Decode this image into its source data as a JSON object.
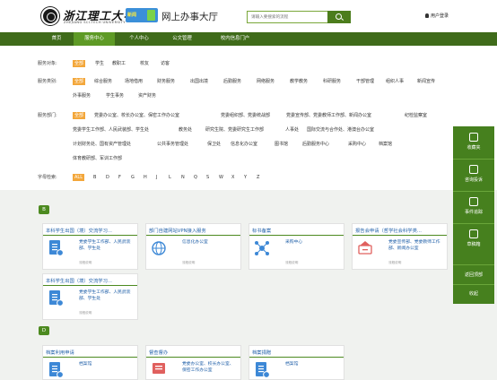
{
  "header": {
    "logo_text": "浙江理工大学",
    "logo_en": "ZHEJIANG SCI-TECH UNIVERSITY",
    "logo_badge": "新闻",
    "site_title": "网上办事大厅",
    "search_placeholder": "请输入要搜索的流程",
    "login": "用户登录"
  },
  "nav": [
    "首页",
    "服务中心",
    "个人中心",
    "公文管理",
    "校内信息门户"
  ],
  "filters": {
    "object": {
      "label": "服务对象:",
      "options": [
        "全部",
        "学生",
        "教职工",
        "校友",
        "访客"
      ]
    },
    "category": {
      "label": "服务类别:",
      "row1": [
        "全部",
        "综合服务",
        "场地借用",
        "财务服务",
        "出国出境",
        "后勤服务",
        "网络服务",
        "教学教务",
        "科研服务",
        "干部管理",
        "组织人事",
        "新闻宣传"
      ],
      "row2": [
        "外事服务",
        "学生事务",
        "资产财务"
      ]
    },
    "dept": {
      "label": "服务部门:",
      "row1": [
        "全部",
        "党委办公室、校长办公室、保密工作办公室",
        "党委组织部、党委统战部",
        "党委宣传部、党委教师工作部、新闻办公室",
        "纪检监察室"
      ],
      "row2": [
        "党委学生工作部、人民武装部、学生处",
        "教务处",
        "研究生院、党委研究生工作部",
        "人事处",
        "国际交流与合作处、港澳台办公室"
      ],
      "row3": [
        "计划财务处、国有资产管理处",
        "公共事务管理处",
        "保卫处",
        "信息化办公室",
        "图书馆",
        "后勤服务中心",
        "采购中心",
        "档案馆"
      ],
      "row4": [
        "体育教研部、军训工作部"
      ]
    },
    "letters": {
      "label": "字母检索:",
      "options": [
        "ALL",
        "B",
        "D",
        "F",
        "G",
        "H",
        "J",
        "L",
        "N",
        "Q",
        "S",
        "W",
        "X",
        "Y",
        "Z"
      ]
    }
  },
  "sections": [
    {
      "letter": "B",
      "cards": [
        {
          "title": "本科学生出国（境）交流学习...",
          "text": "党委学生工作部、人民武装部、学生处",
          "sub": "流程说明"
        },
        {
          "title": "部门自建网站VPN接入服务",
          "text": "信息化办公室",
          "sub": "流程说明"
        },
        {
          "title": "标书备案",
          "text": "采购中心",
          "sub": "流程说明"
        },
        {
          "title": "报告会申请（哲学社会科学类...",
          "text": "党委宣传部、党委教师工作部、新闻办公室",
          "sub": "流程说明"
        },
        {
          "title": "本科学生出国（境）交流学习...",
          "text": "党委学生工作部、人民武装部、学生处",
          "sub": "流程说明"
        }
      ]
    },
    {
      "letter": "D",
      "cards": [
        {
          "title": "档案利用申请",
          "text": "档案馆",
          "sub": "流程说明"
        },
        {
          "title": "督查督办",
          "text": "党委办公室、校长办公室、保密工作办公室",
          "sub": "流程说明"
        },
        {
          "title": "档案捐赠",
          "text": "档案馆",
          "sub": "流程说明"
        }
      ]
    }
  ],
  "sidebar": [
    "收藏夹",
    "咨询投诉",
    "事件追踪",
    "草稿箱",
    "返回顶部",
    "收起"
  ],
  "colors": {
    "accent": "#4c8a1f",
    "nav_bg": "#3f6b1a",
    "link": "#1f5fa8",
    "selected": "#f3a73b"
  }
}
